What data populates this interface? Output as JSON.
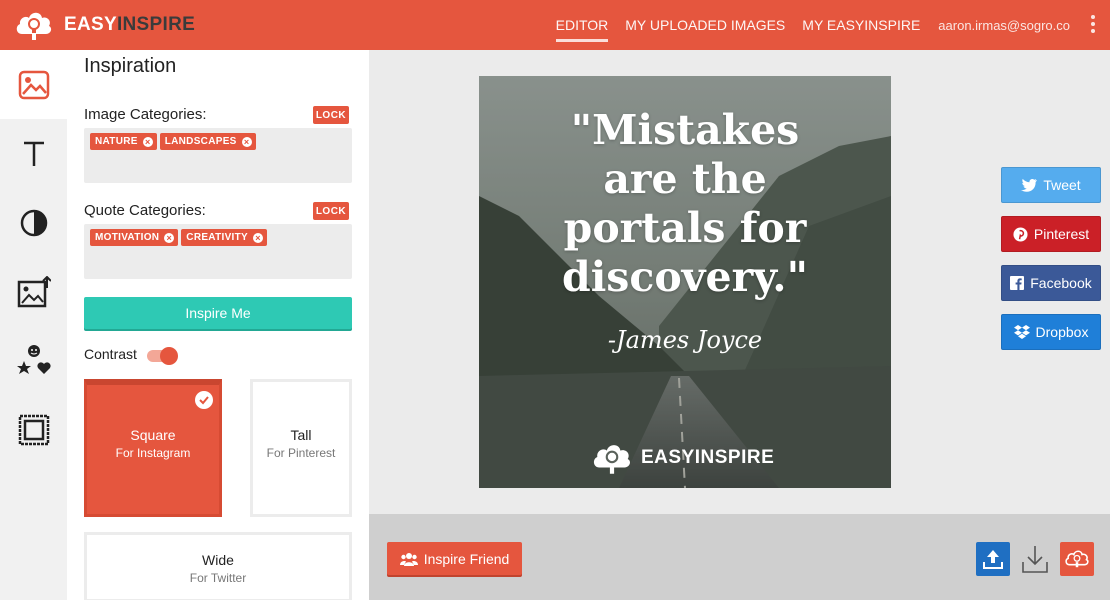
{
  "header": {
    "logo_bold": "EASY",
    "logo_rest": "INSPIRE",
    "nav": [
      {
        "label": "EDITOR",
        "active": true
      },
      {
        "label": "MY UPLOADED IMAGES",
        "active": false
      },
      {
        "label": "MY EASYINSPIRE",
        "active": false
      }
    ],
    "user_email": "aaron.irmas@sogro.co"
  },
  "tools": [
    "image-icon",
    "text-icon",
    "contrast-icon",
    "upload-image-icon",
    "stickers-icon",
    "frame-icon"
  ],
  "panel": {
    "title": "Inspiration",
    "image_categories": {
      "label": "Image Categories:",
      "lock": "LOCK",
      "tags": [
        "NATURE",
        "LANDSCAPES"
      ]
    },
    "quote_categories": {
      "label": "Quote Categories:",
      "lock": "LOCK",
      "tags": [
        "MOTIVATION",
        "CREATIVITY"
      ]
    },
    "inspire_button": "Inspire Me",
    "contrast_label": "Contrast",
    "contrast_on": true,
    "sizes": [
      {
        "name": "Square",
        "sub": "For Instagram",
        "selected": true
      },
      {
        "name": "Tall",
        "sub": "For Pinterest",
        "selected": false
      },
      {
        "name": "Wide",
        "sub": "For Twitter",
        "selected": false
      }
    ]
  },
  "preview": {
    "quote_lines": [
      "\"Mistakes",
      "are the",
      "portals for",
      "discovery.\""
    ],
    "author": "-James Joyce",
    "watermark": "EASYINSPIRE"
  },
  "share": {
    "tweet": "Tweet",
    "pinterest": "Pinterest",
    "facebook": "Facebook",
    "dropbox": "Dropbox"
  },
  "bottom": {
    "inspire_friend": "Inspire Friend"
  },
  "colors": {
    "brand": "#e5563e",
    "teal": "#2ec9b4",
    "twitter": "#55acee",
    "pinterest": "#cb2027",
    "facebook": "#3b5998",
    "dropbox": "#1f7fd8"
  }
}
